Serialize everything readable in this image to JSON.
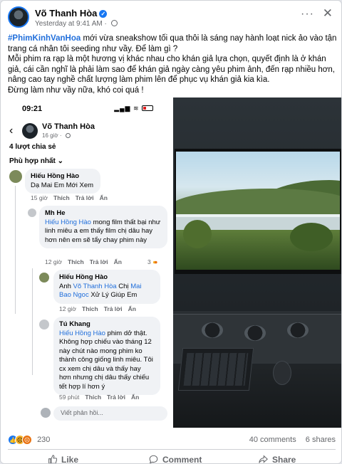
{
  "post": {
    "author": "Võ Thanh Hòa",
    "timestamp": "Yesterday at 9:41 AM",
    "hashtag": "#PhimKinhVanHoa",
    "text_line1_rest": " mới vừa sneakshow tối qua thôi là sáng nay hành loạt nick ảo vào tận trang cá nhân tôi seeding như vầy. Để làm gì ?",
    "text_line2": "Mỗi phim ra rạp là một hương vị khác nhau cho khán giả lựa chọn, quyết định là ở khán giả, cái cần nghĩ là phải làm sao để khán giả ngày càng yêu phim ảnh, đến rạp nhiều hơn, nâng cao tay nghề chất lượng làm phim lên để phục vụ khán giả kia kìa.",
    "text_line3": "Đừng làm như vầy nữa, khó coi quá !"
  },
  "phone": {
    "time": "09:21",
    "page_name": "Võ Thanh Hòa",
    "page_age": "16 giờ",
    "shares": "4 lượt chia sẻ",
    "filter": "Phù hợp nhất",
    "reply_placeholder": "Viết phản hồi...",
    "comments": [
      {
        "name": "Hiếu Hồng Hào",
        "text": "Dạ Mai Em Mới Xem",
        "time": "15 giờ",
        "like": "Thích",
        "reply": "Trả lời",
        "hide": "Ẩn"
      },
      {
        "name": "Mh He",
        "mention": "Hiếu Hồng Hào",
        "text": " mong film thất bại như linh miêu a em thấy film chị dâu hay hơn nên em sẽ tẩy chay phim này",
        "time": "12 giờ",
        "like": "Thích",
        "reply": "Trả lời",
        "hide": "Ẩn",
        "reactions": "3"
      },
      {
        "name": "Hiếu Hồng Hào",
        "prefix": "Anh ",
        "mention": "Võ Thanh Hòa",
        "middle": " Chị ",
        "mention2": "Mai Bao Ngoc",
        "text": " Xử Lý Giúp Em",
        "time": "12 giờ",
        "like": "Thích",
        "reply": "Trả lời",
        "hide": "Ẩn"
      },
      {
        "name": "Tú Khang",
        "mention": "Hiếu Hồng Hào",
        "text": " phim dở thật. Không hợp chiếu vào tháng 12 này chút nào mong phim ko thành công giống linh miêu. Tôi cx xem chị dâu và thấy hay hơn nhưng chị dâu thấy chiếu tết hợp lí hơn ý",
        "time": "59 phút",
        "like": "Thích",
        "reply": "Trả lời",
        "hide": "Ẩn"
      }
    ]
  },
  "stats": {
    "reaction_count": "230",
    "comments": "40 comments",
    "shares": "6 shares"
  },
  "actions": {
    "like": "Like",
    "comment": "Comment",
    "share": "Share"
  },
  "colors": {
    "accent": "#1877f2",
    "link": "#216fdb"
  }
}
